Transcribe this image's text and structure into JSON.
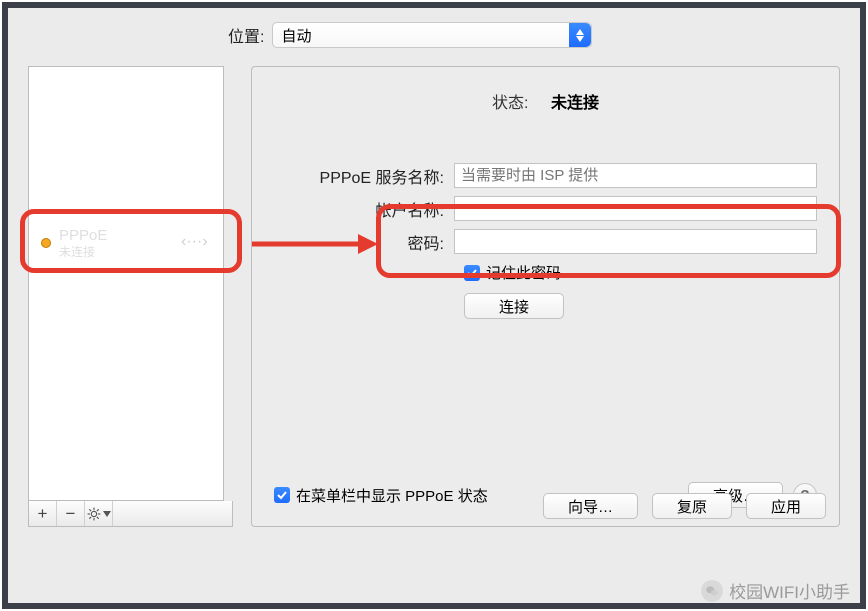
{
  "location": {
    "label": "位置:",
    "value": "自动"
  },
  "sidebar": {
    "item": {
      "title": "PPPoE",
      "subtitle": "未连接"
    }
  },
  "toolbar": {
    "add": "+",
    "remove": "−"
  },
  "panel": {
    "status_label": "状态:",
    "status_value": "未连接",
    "service_label": "PPPoE 服务名称:",
    "service_placeholder": "当需要时由 ISP 提供",
    "account_label": "帐户名称:",
    "password_label": "密码:",
    "remember_label": "记住此密码",
    "connect": "连接",
    "menubar_label": "在菜单栏中显示 PPPoE 状态",
    "advanced": "高级…",
    "help": "?"
  },
  "buttons": {
    "wizard": "向导…",
    "revert": "复原",
    "apply": "应用"
  },
  "watermark": {
    "text": "校园WIFI小助手"
  },
  "colors": {
    "highlight": "#e53b2e",
    "accent": "#1e6cff",
    "status_dot": "#f5a623"
  }
}
